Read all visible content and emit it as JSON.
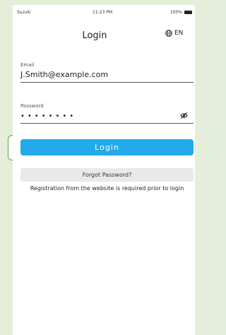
{
  "status_bar": {
    "carrier": "Suzuki",
    "time": "11:23 PM",
    "battery": "100%"
  },
  "header": {
    "title": "Login",
    "language": "EN"
  },
  "email": {
    "label": "Email",
    "value": "J.Smith@example.com"
  },
  "password": {
    "label": "Password",
    "value": "••••••••"
  },
  "buttons": {
    "login": "Login",
    "forgot": "Forgot Password?"
  },
  "note": "Registration from the website is required prior to login",
  "colors": {
    "accent": "#22a9ea",
    "highlight": "#57a845",
    "background": "#e4eedb"
  }
}
